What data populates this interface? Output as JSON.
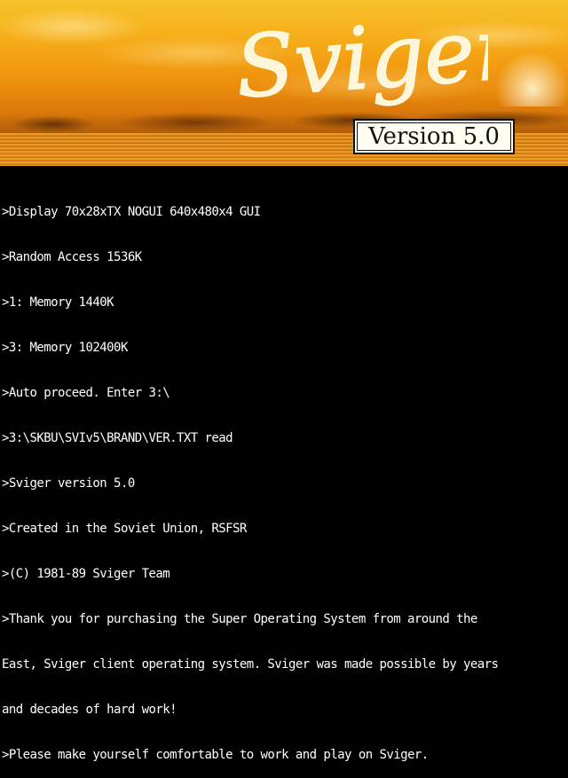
{
  "banner": {
    "logo_text": "Sviger",
    "version_label": "Version 5.0"
  },
  "console": {
    "lines": [
      ">Display 70x28xTX NOGUI 640x480x4 GUI",
      ">Random Access 1536K",
      ">1: Memory 1440K",
      ">3: Memory 102400K",
      ">Auto proceed. Enter 3:\\",
      ">3:\\SKBU\\SVIv5\\BRAND\\VER.TXT read",
      ">Sviger version 5.0",
      ">Created in the Soviet Union, RSFSR",
      ">(C) 1981-89 Sviger Team",
      ">Thank you for purchasing the Super Operating System from around the",
      "East, Sviger client operating system. Sviger was made possible by years",
      "and decades of hard work!",
      ">Please make yourself comfortable to work and play on Sviger."
    ]
  }
}
